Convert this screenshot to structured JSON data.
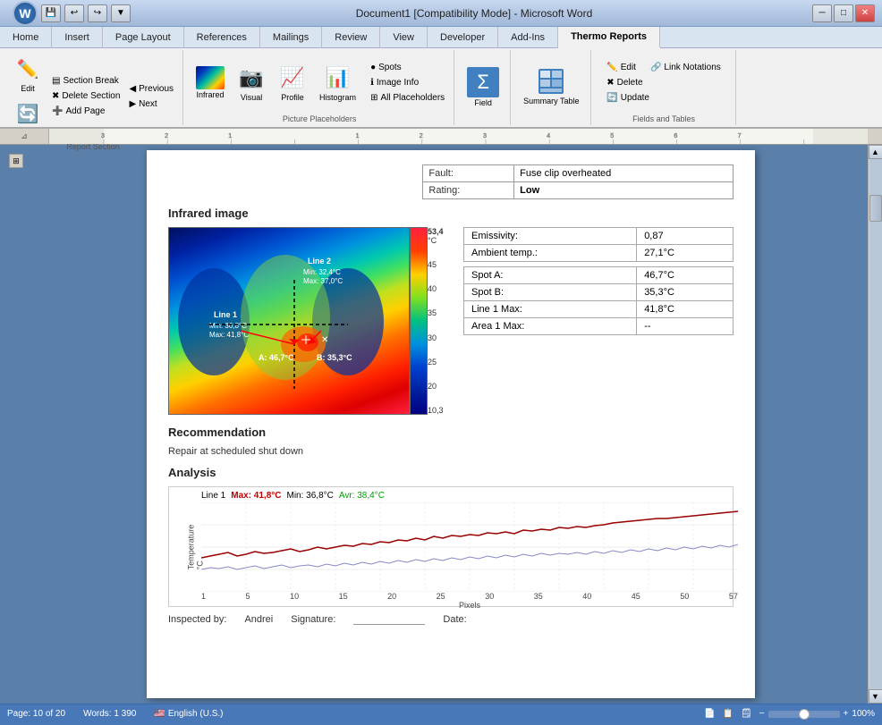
{
  "window": {
    "title": "Document1 [Compatibility Mode] - Microsoft Word",
    "min_btn": "─",
    "restore_btn": "□",
    "close_btn": "✕"
  },
  "ribbon": {
    "tabs": [
      "Home",
      "Insert",
      "Page Layout",
      "References",
      "Mailings",
      "Review",
      "View",
      "Developer",
      "Add-Ins",
      "Thermo Reports"
    ],
    "active_tab": "Thermo Reports",
    "groups": {
      "report_section": {
        "label": "Report Section",
        "buttons": [
          {
            "id": "edit",
            "label": "Edit",
            "icon": "✏️"
          },
          {
            "id": "update",
            "label": "Update",
            "icon": "🔄"
          }
        ],
        "small_buttons": [
          {
            "id": "section-break",
            "label": "Section Break",
            "icon": "▤"
          },
          {
            "id": "delete-section",
            "label": "Delete Section",
            "icon": "✖"
          },
          {
            "id": "add-page",
            "label": "Add Page",
            "icon": "➕"
          },
          {
            "id": "previous",
            "label": "Previous",
            "icon": "◀"
          },
          {
            "id": "next",
            "label": "Next",
            "icon": "▶"
          }
        ]
      },
      "picture_placeholders": {
        "label": "Picture Placeholders",
        "buttons": [
          {
            "id": "infrared",
            "label": "Infrared",
            "icon": "🌡"
          },
          {
            "id": "visual",
            "label": "Visual",
            "icon": "📷"
          },
          {
            "id": "profile",
            "label": "Profile",
            "icon": "📈"
          },
          {
            "id": "histogram",
            "label": "Histogram",
            "icon": "📊"
          }
        ],
        "small_buttons": [
          {
            "id": "spots",
            "label": "Spots",
            "icon": "●"
          },
          {
            "id": "image-info",
            "label": "Image Info",
            "icon": "ℹ"
          },
          {
            "id": "all-placeholders",
            "label": "All Placeholders",
            "icon": "⊞"
          }
        ]
      },
      "field": {
        "label": "",
        "buttons": [
          {
            "id": "field",
            "label": "Field",
            "icon": "Σ"
          }
        ]
      },
      "summary_table": {
        "label": "Summary Table",
        "buttons": [
          {
            "id": "summary-table",
            "label": "Summary Table",
            "icon": "⊞"
          }
        ]
      },
      "fields_and_tables": {
        "label": "Fields and Tables",
        "small_buttons": [
          {
            "id": "edit2",
            "label": "Edit",
            "icon": "✏️"
          },
          {
            "id": "delete2",
            "label": "Delete",
            "icon": "✖"
          },
          {
            "id": "update2",
            "label": "Update",
            "icon": "🔄"
          },
          {
            "id": "link-notations",
            "label": "Link Notations",
            "icon": "🔗"
          }
        ]
      }
    }
  },
  "document": {
    "top_table": {
      "rows": [
        {
          "label": "Fault:",
          "value": "Fuse clip overheated"
        },
        {
          "label": "Rating:",
          "value": "Low"
        }
      ]
    },
    "infrared_section": {
      "title": "Infrared image",
      "scale_max": "53,4",
      "scale_unit": "°C",
      "scale_values": [
        "45",
        "40",
        "35",
        "30",
        "25",
        "20"
      ],
      "scale_min": "10,3",
      "line1_label": "Line 1",
      "line1_min": "Min: 36,8°C",
      "line1_max": "Max: 41,8°C",
      "line2_label": "Line 2",
      "line2_min": "Min: 32,4°C",
      "line2_max": "Max: 37,0°C",
      "spotA_label": "A: 46,7°C",
      "spotB_label": "B: 35,3°C",
      "data_table": {
        "rows": [
          {
            "label": "Emissivity:",
            "value": "0,87"
          },
          {
            "label": "Ambient temp.:",
            "value": "27,1°C"
          },
          {
            "label": "---sep---",
            "value": ""
          },
          {
            "label": "Spot A:",
            "value": "46,7°C"
          },
          {
            "label": "Spot B:",
            "value": "35,3°C"
          },
          {
            "label": "Line 1 Max:",
            "value": "41,8°C"
          },
          {
            "label": "Area 1 Max:",
            "value": "--"
          }
        ]
      }
    },
    "recommendation": {
      "title": "Recommendation",
      "text": "Repair at scheduled shut down"
    },
    "analysis": {
      "title": "Analysis",
      "chart_label": "Line 1",
      "chart_max_label": "Max: 41,8°C",
      "chart_min_label": "Min: 36,8°C",
      "chart_avr_label": "Avr: 38,4°C",
      "y_axis_label": "Temperature",
      "y_unit": "°C",
      "y_max": "42",
      "y_min": "32",
      "x_axis_label": "Pixels",
      "x_values": [
        "1",
        "5",
        "10",
        "15",
        "20",
        "25",
        "30",
        "35",
        "40",
        "45",
        "50",
        "57"
      ]
    }
  },
  "status_bar": {
    "page_info": "Page: 10 of 20",
    "words": "Words: 1 390",
    "language": "English (U.S.)",
    "zoom": "100%",
    "inspected_by_label": "Inspected by:",
    "inspected_by_value": "Andrei",
    "signature_label": "Signature:",
    "date_label": "Date:"
  }
}
